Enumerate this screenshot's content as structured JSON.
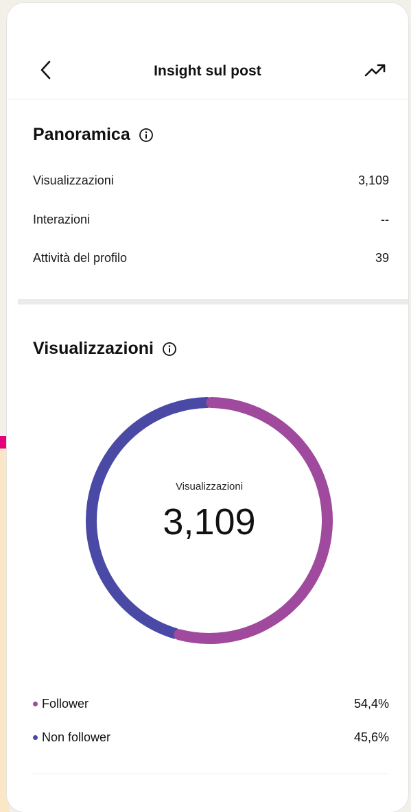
{
  "header": {
    "title": "Insight sul post",
    "back_icon": "chevron-left-icon",
    "trend_icon": "trending-up-icon"
  },
  "overview": {
    "title": "Panoramica",
    "info_icon": "info-icon",
    "rows": [
      {
        "label": "Visualizzazioni",
        "value": "3,109"
      },
      {
        "label": "Interazioni",
        "value": "--"
      },
      {
        "label": "Attività del profilo",
        "value": "39"
      }
    ]
  },
  "views": {
    "title": "Visualizzazioni",
    "info_icon": "info-icon",
    "center_label": "Visualizzazioni",
    "center_value": "3,109",
    "legend": [
      {
        "label": "Follower",
        "value": "54,4%",
        "color": "#a04a9e"
      },
      {
        "label": "Non follower",
        "value": "45,6%",
        "color": "#4a4aa6"
      }
    ]
  },
  "chart_data": {
    "type": "pie",
    "title": "",
    "categories": [
      "Follower",
      "Non follower"
    ],
    "values": [
      54.4,
      45.6
    ],
    "colors": [
      "#a04a9e",
      "#4a4aa6"
    ]
  },
  "colors": {
    "follower": "#a04a9e",
    "non_follower": "#4a4aa6",
    "divider": "#ebebeb"
  }
}
